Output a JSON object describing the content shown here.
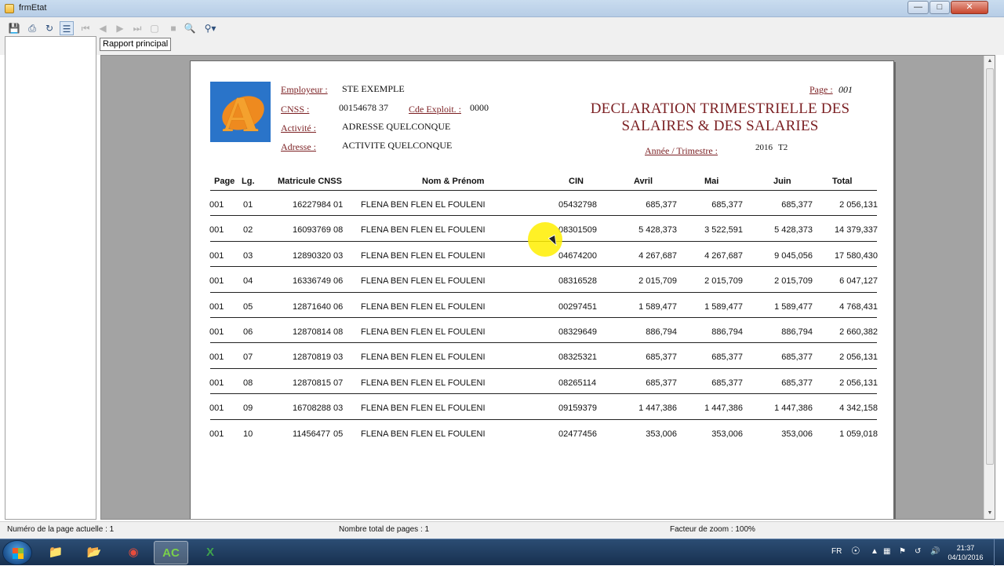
{
  "window": {
    "title": "frmEtat"
  },
  "toolbar": {
    "icons": [
      "export-icon",
      "print-icon",
      "refresh-icon",
      "group-tree-icon",
      "first-page-icon",
      "prev-page-icon",
      "next-page-icon",
      "last-page-icon",
      "goto-page-icon",
      "stop-icon",
      "find-icon",
      "zoom-icon"
    ]
  },
  "tabs": {
    "main": "Rapport principal"
  },
  "report": {
    "labels": {
      "employer": "Employeur :",
      "cnss": "CNSS :",
      "cde_exploit": "Cde Exploit. :",
      "activity": "Activité :",
      "address": "Adresse :",
      "page": "Page :",
      "year_quarter": "Année / Trimestre :"
    },
    "values": {
      "employer": "STE EXEMPLE",
      "cnss": "00154678  37",
      "cde_exploit": "0000",
      "activity": "ADRESSE QUELCONQUE",
      "address": "ACTIVITE QUELCONQUE",
      "page": "001",
      "year": "2016",
      "quarter": "T2"
    },
    "title_line1": "DECLARATION TRIMESTRIELLE DES",
    "title_line2": "SALAIRES & DES SALARIES",
    "columns": {
      "page": "Page",
      "line": "Lg.",
      "matricule": "Matricule CNSS",
      "name": "Nom & Prénom",
      "cin": "CIN",
      "avril": "Avril",
      "mai": "Mai",
      "juin": "Juin",
      "total": "Total"
    },
    "rows": [
      {
        "page": "001",
        "lg": "01",
        "matricule": "16227984",
        "key": "01",
        "name": "FLENA BEN FLEN EL FOULENI",
        "cin": "05432798",
        "avril": "685,377",
        "mai": "685,377",
        "juin": "685,377",
        "total": "2 056,131"
      },
      {
        "page": "001",
        "lg": "02",
        "matricule": "16093769",
        "key": "08",
        "name": "FLENA BEN FLEN EL FOULENI",
        "cin": "08301509",
        "avril": "5 428,373",
        "mai": "3 522,591",
        "juin": "5 428,373",
        "total": "14 379,337"
      },
      {
        "page": "001",
        "lg": "03",
        "matricule": "12890320",
        "key": "03",
        "name": "FLENA BEN FLEN EL FOULENI",
        "cin": "04674200",
        "avril": "4 267,687",
        "mai": "4 267,687",
        "juin": "9 045,056",
        "total": "17 580,430"
      },
      {
        "page": "001",
        "lg": "04",
        "matricule": "16336749",
        "key": "06",
        "name": "FLENA BEN FLEN EL FOULENI",
        "cin": "08316528",
        "avril": "2 015,709",
        "mai": "2 015,709",
        "juin": "2 015,709",
        "total": "6 047,127"
      },
      {
        "page": "001",
        "lg": "05",
        "matricule": "12871640",
        "key": "06",
        "name": "FLENA BEN FLEN EL FOULENI",
        "cin": "00297451",
        "avril": "1 589,477",
        "mai": "1 589,477",
        "juin": "1 589,477",
        "total": "4 768,431"
      },
      {
        "page": "001",
        "lg": "06",
        "matricule": "12870814",
        "key": "08",
        "name": "FLENA BEN FLEN EL FOULENI",
        "cin": "08329649",
        "avril": "886,794",
        "mai": "886,794",
        "juin": "886,794",
        "total": "2 660,382"
      },
      {
        "page": "001",
        "lg": "07",
        "matricule": "12870819",
        "key": "03",
        "name": "FLENA BEN FLEN EL FOULENI",
        "cin": "08325321",
        "avril": "685,377",
        "mai": "685,377",
        "juin": "685,377",
        "total": "2 056,131"
      },
      {
        "page": "001",
        "lg": "08",
        "matricule": "12870815",
        "key": "07",
        "name": "FLENA BEN FLEN EL FOULENI",
        "cin": "08265114",
        "avril": "685,377",
        "mai": "685,377",
        "juin": "685,377",
        "total": "2 056,131"
      },
      {
        "page": "001",
        "lg": "09",
        "matricule": "16708288",
        "key": "03",
        "name": "FLENA BEN FLEN EL FOULENI",
        "cin": "09159379",
        "avril": "1 447,386",
        "mai": "1 447,386",
        "juin": "1 447,386",
        "total": "4 342,158"
      },
      {
        "page": "001",
        "lg": "10",
        "matricule": "11456477",
        "key": "05",
        "name": "FLENA BEN FLEN EL FOULENI",
        "cin": "02477456",
        "avril": "353,006",
        "mai": "353,006",
        "juin": "353,006",
        "total": "1 059,018"
      }
    ]
  },
  "status": {
    "current_page": "Numéro de la page actuelle : 1",
    "total_pages": "Nombre total de pages : 1",
    "zoom": "Facteur de zoom : 100%"
  },
  "taskbar": {
    "apps": [
      "windows-explorer-icon",
      "folder-icon",
      "chrome-icon",
      "windev-icon",
      "excel-icon"
    ],
    "lang": "FR",
    "time": "21:37",
    "date": "04/10/2016"
  },
  "colors": {
    "accent": "#7b1f22",
    "viewer_bg": "#a3a3a3",
    "highlight": "#ffee00"
  }
}
